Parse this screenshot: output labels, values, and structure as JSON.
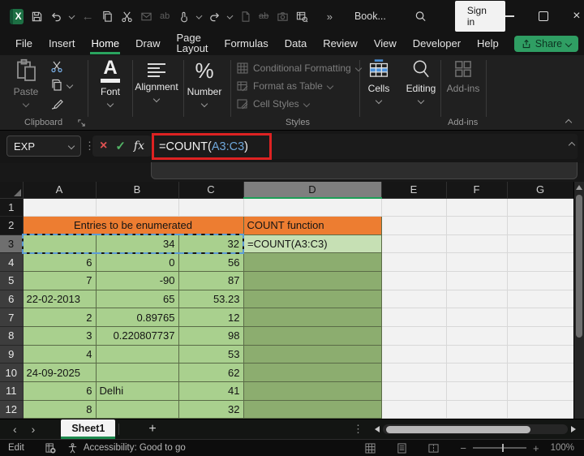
{
  "titlebar": {
    "workbook_name": "Book...",
    "signin_label": "Sign in"
  },
  "menubar": {
    "tabs": [
      "File",
      "Insert",
      "Home",
      "Draw",
      "Page Layout",
      "Formulas",
      "Data",
      "Review",
      "View",
      "Developer",
      "Help"
    ],
    "active_tab": "Home",
    "share_label": "Share"
  },
  "ribbon": {
    "paste": "Paste",
    "font": "Font",
    "alignment": "Alignment",
    "number": "Number",
    "conditional_formatting": "Conditional Formatting",
    "format_as_table": "Format as Table",
    "cell_styles": "Cell Styles",
    "cells": "Cells",
    "editing": "Editing",
    "addins_button": "Add-ins",
    "clipboard_group": "Clipboard",
    "styles_group": "Styles",
    "addins_group": "Add-ins"
  },
  "formula_bar": {
    "name_box": "EXP",
    "fx": "fx",
    "cancel": "×",
    "enter": "✓",
    "formula_prefix": "=COUNT(",
    "formula_ref": "A3:C3",
    "formula_suffix": ")"
  },
  "grid": {
    "columns": [
      "A",
      "B",
      "C",
      "D",
      "E",
      "F",
      "G"
    ],
    "selected_column": "D",
    "row1": "1",
    "row2": {
      "n": "2",
      "merged_abc": "Entries to be enumerated",
      "d": "COUNT function"
    },
    "data_rows": [
      {
        "n": "3",
        "a": "",
        "b": "34",
        "c": "32",
        "d": "=COUNT(A3:C3)"
      },
      {
        "n": "4",
        "a": "6",
        "b": "0",
        "c": "56",
        "d": ""
      },
      {
        "n": "5",
        "a": "7",
        "b": "-90",
        "c": "87",
        "d": ""
      },
      {
        "n": "6",
        "a": "22-02-2013",
        "b": "65",
        "c": "53.23",
        "d": ""
      },
      {
        "n": "7",
        "a": "2",
        "b": "0.89765",
        "c": "12",
        "d": ""
      },
      {
        "n": "8",
        "a": "3",
        "b": "0.220807737",
        "c": "98",
        "d": ""
      },
      {
        "n": "9",
        "a": "4",
        "b": "",
        "c": "53",
        "d": ""
      },
      {
        "n": "10",
        "a": "24-09-2025",
        "b": "",
        "c": "62",
        "d": ""
      },
      {
        "n": "11",
        "a": "6",
        "b": "Delhi",
        "c": "41",
        "d": ""
      },
      {
        "n": "12",
        "a": "8",
        "b": "",
        "c": "32",
        "d": ""
      }
    ]
  },
  "sheetbar": {
    "tab": "Sheet1"
  },
  "statusbar": {
    "mode": "Edit",
    "accessibility": "Accessibility: Good to go",
    "zoom_level": "100%"
  },
  "icons": {
    "more_commands": "»",
    "vertical_dots": "⋮",
    "back_arrow": "←",
    "plus": "+",
    "nav_left": "‹",
    "nav_right": "›",
    "minus": "−",
    "close": "×",
    "ab_replace": "ab",
    "ab_strike": "ab"
  },
  "colors": {
    "accent_green": "#21a366",
    "header_orange": "#ED7D31",
    "cell_green_light": "#A9D08E",
    "cell_green_lighter": "#C6E0B4",
    "cell_green_dark": "#8CAD6F",
    "selection_blue": "#5b9bd5",
    "highlight_red": "#dd2222"
  }
}
